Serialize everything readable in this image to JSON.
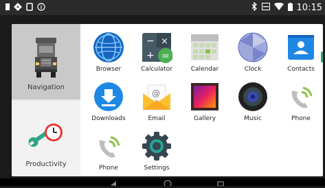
{
  "status": {
    "time": "10:15"
  },
  "sidebar": {
    "categories": [
      {
        "label": "Navigation"
      },
      {
        "label": "Productivity"
      }
    ]
  },
  "apps": [
    {
      "label": "Browser"
    },
    {
      "label": "Calculator"
    },
    {
      "label": "Calendar"
    },
    {
      "label": "Clock"
    },
    {
      "label": "Contacts"
    },
    {
      "label": "Downloads"
    },
    {
      "label": "Email"
    },
    {
      "label": "Gallery"
    },
    {
      "label": "Music"
    },
    {
      "label": "Phone"
    },
    {
      "label": "Phone"
    },
    {
      "label": "Settings"
    }
  ],
  "colors": {
    "accent": "#2fa58a",
    "download_blue": "#1e88e5",
    "contacts_blue": "#1e88e5",
    "calculator_dark": "#455a64",
    "calculator_green": "#4caf50"
  },
  "icons": {
    "status_left": [
      "notification-icon",
      "navigation-diamond-icon",
      "screenshot-icon",
      "info-icon"
    ],
    "status_right": [
      "bluetooth-icon",
      "cast-icon",
      "wifi-icon",
      "battery-icon"
    ]
  }
}
